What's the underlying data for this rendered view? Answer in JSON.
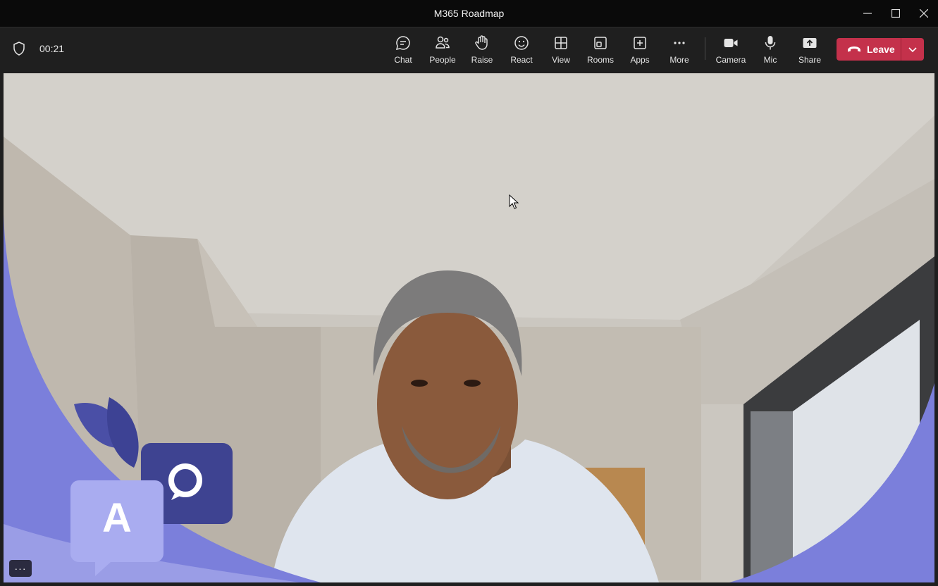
{
  "window": {
    "title": "M365 Roadmap"
  },
  "call": {
    "timer": "00:21"
  },
  "toolbar": {
    "items": [
      {
        "label": "Chat",
        "icon": "chat-icon"
      },
      {
        "label": "People",
        "icon": "people-icon"
      },
      {
        "label": "Raise",
        "icon": "hand-icon"
      },
      {
        "label": "React",
        "icon": "smiley-icon"
      },
      {
        "label": "View",
        "icon": "grid-icon"
      },
      {
        "label": "Rooms",
        "icon": "rooms-icon"
      },
      {
        "label": "Apps",
        "icon": "plus-square-icon"
      },
      {
        "label": "More",
        "icon": "ellipsis-icon"
      },
      {
        "label": "Camera",
        "icon": "camera-icon"
      },
      {
        "label": "Mic",
        "icon": "mic-icon"
      },
      {
        "label": "Share",
        "icon": "share-icon"
      }
    ],
    "leave_label": "Leave"
  },
  "stage": {
    "background_letter": "A",
    "more_label": "···"
  },
  "colors": {
    "leave": "#c4314b",
    "accent_purple": "#7b7fdb",
    "titlebar": "#0a0a0a",
    "toolbar": "#1f1f1f"
  }
}
